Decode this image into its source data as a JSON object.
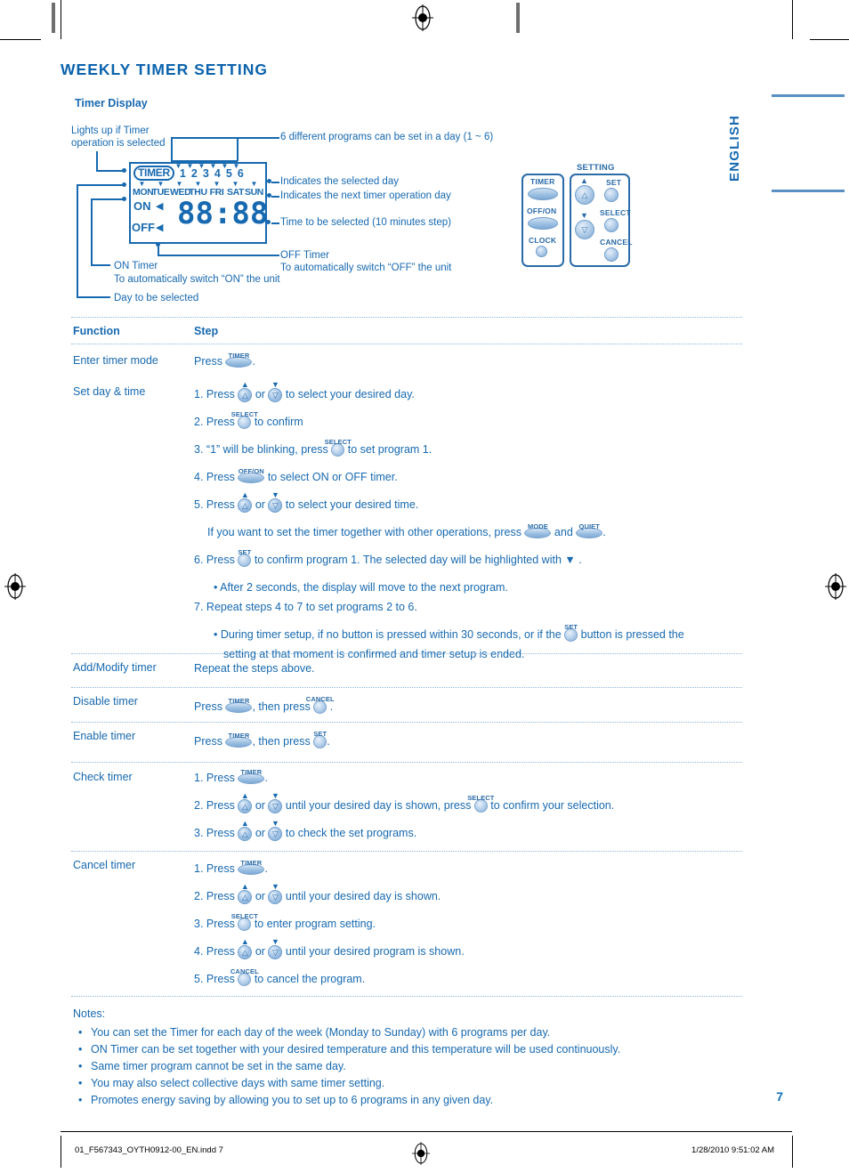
{
  "page": {
    "title": "WEEKLY TIMER SETTING",
    "subhead": "Timer Display",
    "language_tab": "ENGLISH",
    "page_number": "7"
  },
  "diagram": {
    "lcd": {
      "timer_label": "TIMER",
      "program_numbers": [
        "1",
        "2",
        "3",
        "4",
        "5",
        "6"
      ],
      "days": [
        "MON",
        "TUE",
        "WED",
        "THU",
        "FRI",
        "SAT",
        "SUN"
      ],
      "on_label": "ON",
      "off_label": "OFF",
      "digits": "88:88"
    },
    "callouts": {
      "lights_up_line1": "Lights up if Timer",
      "lights_up_line2": "operation is selected",
      "programs": "6 different programs can be set in a day (1 ~ 6)",
      "selected_day": "Indicates the selected day",
      "next_day": "Indicates the next timer operation day",
      "time_step": "Time to be selected (10 minutes step)",
      "off_timer_line1": "OFF Timer",
      "off_timer_line2": "To automatically switch “OFF” the unit",
      "on_timer_line1": "ON Timer",
      "on_timer_line2": "To automatically switch “ON” the unit",
      "day_selected": "Day to be selected"
    }
  },
  "remote": {
    "setting_label": "SETTING",
    "timer_label": "TIMER",
    "offon_label": "OFF/ON",
    "clock_label": "CLOCK",
    "set_label": "SET",
    "select_label": "SELECT",
    "cancel_label": "CANCEL"
  },
  "table": {
    "headers": {
      "function": "Function",
      "step": "Step"
    },
    "rows": [
      {
        "function": "Enter timer mode",
        "lines": [
          {
            "pre": "Press ",
            "btn": "timer-oval",
            "post": "."
          }
        ]
      },
      {
        "function": "Set day & time",
        "lines": [
          {
            "num": "1.",
            "pre": " Press ",
            "btn": "up",
            "mid": " or ",
            "btn2": "down",
            "post": " to select your desired day."
          },
          {
            "num": "2.",
            "pre": " Press ",
            "btn": "select-round",
            "post": " to confirm"
          },
          {
            "num": "3.",
            "pre": " “1” will be blinking, press ",
            "btn": "select-round",
            "post": " to set program 1."
          },
          {
            "num": "4.",
            "pre": " Press ",
            "btn": "offon-oval",
            "post": " to select ON or OFF timer."
          },
          {
            "num": "5.",
            "pre": " Press ",
            "btn": "up",
            "mid": " or ",
            "btn2": "down",
            "post": " to select your desired time."
          },
          {
            "indent": true,
            "pre": "If you want to set the timer together with other operations, press ",
            "btn": "mode-oval",
            "mid": " and ",
            "btn2": "quiet-oval",
            "post": "."
          },
          {
            "num": "6.",
            "pre": " Press ",
            "btn": "set-round",
            "post": " to confirm program 1. The selected day will be highlighted with ▼ ."
          },
          {
            "bullet": true,
            "pre": "After 2 seconds, the display will move to the next program."
          },
          {
            "num": "7.",
            "pre": " Repeat steps 4 to 7 to set programs 2 to 6."
          },
          {
            "bullet": true,
            "pre": "During timer setup, if no button is pressed within 30 seconds, or if the ",
            "btn": "set-round",
            "post": " button is pressed the"
          },
          {
            "bulletcont": true,
            "pre": "setting at that moment is confirmed and timer setup is ended."
          }
        ]
      },
      {
        "function": "Add/Modify timer",
        "lines": [
          {
            "pre": "Repeat the steps above."
          }
        ]
      },
      {
        "function": "Disable timer",
        "lines": [
          {
            "pre": "Press ",
            "btn": "timer-oval",
            "mid": ", then press ",
            "btn2": "cancel-round",
            "post": " ."
          }
        ]
      },
      {
        "function": "Enable timer",
        "lines": [
          {
            "pre": "Press ",
            "btn": "timer-oval",
            "mid": ", then press ",
            "btn2": "set-round",
            "post": "."
          }
        ]
      },
      {
        "function": "Check timer",
        "lines": [
          {
            "num": "1.",
            "pre": " Press ",
            "btn": "timer-oval",
            "post": "."
          },
          {
            "num": "2.",
            "pre": " Press ",
            "btn": "up",
            "mid": " or ",
            "btn2": "down",
            "post": " until your desired day is shown, press ",
            "btn3": "select-round",
            "post2": " to confirm your selection."
          },
          {
            "num": "3.",
            "pre": " Press ",
            "btn": "up",
            "mid": " or ",
            "btn2": "down",
            "post": " to check the set programs."
          }
        ]
      },
      {
        "function": "Cancel timer",
        "lines": [
          {
            "num": "1.",
            "pre": " Press ",
            "btn": "timer-oval",
            "post": "."
          },
          {
            "num": "2.",
            "pre": " Press ",
            "btn": "up",
            "mid": " or ",
            "btn2": "down",
            "post": " until your desired day is shown."
          },
          {
            "num": "3.",
            "pre": " Press ",
            "btn": "select-round",
            "post": " to enter program setting."
          },
          {
            "num": "4.",
            "pre": " Press ",
            "btn": "up",
            "mid": " or ",
            "btn2": "down",
            "post": " until your desired program is shown."
          },
          {
            "num": "5.",
            "pre": " Press ",
            "btn": "cancel-round",
            "post": " to cancel the program."
          }
        ]
      }
    ]
  },
  "notes": {
    "title": "Notes:",
    "items": [
      "You can set the Timer for each day of the week (Monday to Sunday) with 6 programs per day.",
      "ON Timer can be set together with your desired temperature and this temperature will be used continuously.",
      "Same timer program cannot be set in the same day.",
      "You may also select collective days with same timer setting.",
      "Promotes energy saving by allowing you to set up to 6 programs in any given day."
    ]
  },
  "footer": {
    "filename": "01_F567343_OYTH0912-00_EN.indd   7",
    "datetime": "1/28/2010   9:51:02 AM"
  },
  "colorbars": {
    "gray_steps": [
      "#000000",
      "#1c1c1c",
      "#303030",
      "#454545",
      "#5c5c5c",
      "#767676",
      "#909090",
      "#aaaaaa",
      "#c4c4c4",
      "#e4e4e4",
      "#ffffff"
    ],
    "colors": [
      "#ffed00",
      "#e5007d",
      "#00a0e9",
      "#2b3990",
      "#00a650",
      "#ed1c24",
      "#231f20",
      "#fdf1a0",
      "#f59bc1",
      "#6fcff6",
      "#939598"
    ]
  },
  "colors": {
    "brand_blue": "#1769b0",
    "title_blue": "#0b63ad",
    "rule_blue": "#5a8fc4",
    "dotted_blue": "#8fb6d8"
  }
}
